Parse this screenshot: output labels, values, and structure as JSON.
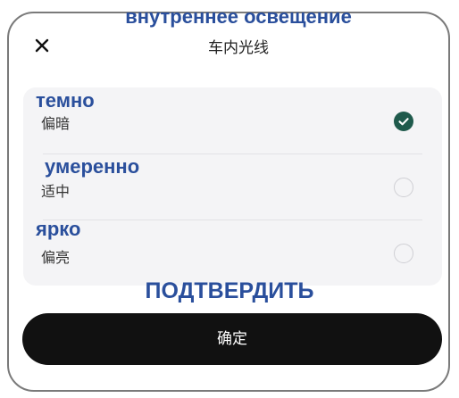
{
  "header": {
    "title_ru": "внутреннее освещение",
    "title_cn": "车内光线",
    "close_icon": "close-icon"
  },
  "options": [
    {
      "label_ru": "темно",
      "label_cn": "偏暗",
      "selected": true,
      "icon": "check-circle-icon"
    },
    {
      "label_ru": "умеренно",
      "label_cn": "适中",
      "selected": false,
      "icon": "radio-empty-icon"
    },
    {
      "label_ru": "ярко",
      "label_cn": "偏亮",
      "selected": false,
      "icon": "radio-empty-icon"
    }
  ],
  "confirm": {
    "label_ru": "ПОДТВЕРДИТЬ",
    "label_cn": "确定"
  },
  "colors": {
    "overlay_text": "#2a4f9c",
    "selected": "#1f5a4c",
    "button_bg": "#111111",
    "card_bg": "#f4f4f6"
  }
}
